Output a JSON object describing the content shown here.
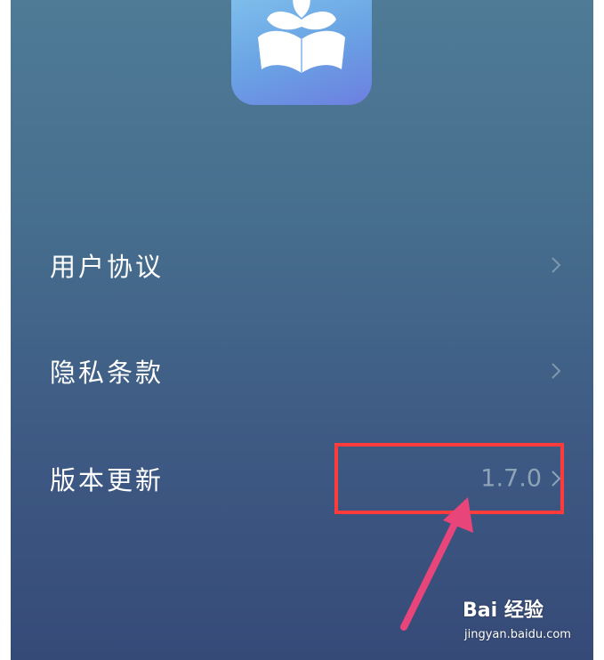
{
  "menu": {
    "items": [
      {
        "label": "用户协议",
        "icon": "chevron-right-icon"
      },
      {
        "label": "隐私条款",
        "icon": "chevron-right-icon"
      },
      {
        "label": "版本更新",
        "value": "1.7.0",
        "icon": "chevron-right-icon"
      }
    ]
  },
  "app_icon": {
    "name": "book-leaf-icon"
  },
  "annotation": {
    "highlight_color": "#ff3b3b",
    "arrow_color": "#e8457a"
  },
  "watermark": {
    "logo": "Bai  经验",
    "url": "jingyan.baidu.com"
  },
  "colors": {
    "background_top": "#4f7b97",
    "background_bottom": "#364a78",
    "label_text": "#ffffff",
    "value_text": "#8ea3b8"
  }
}
